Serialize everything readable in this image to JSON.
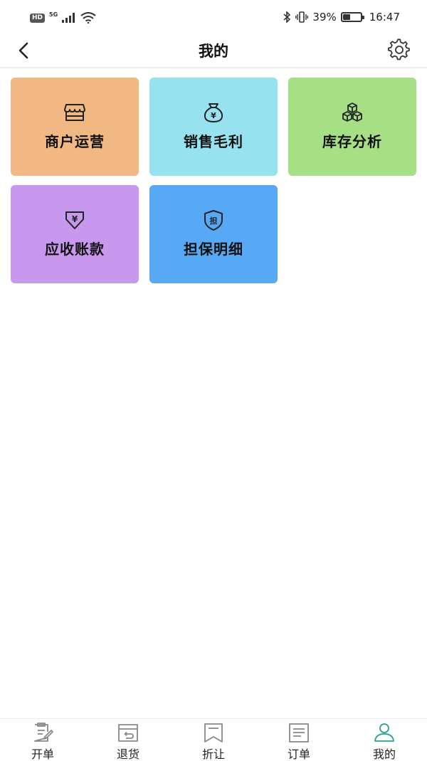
{
  "status_bar": {
    "hd": "HD",
    "network": "5G",
    "battery_percent": "39%",
    "battery_level": 0.39,
    "time": "16:47"
  },
  "header": {
    "title": "我的",
    "back_icon": "chevron-left-icon",
    "settings_icon": "gear-icon"
  },
  "tiles": [
    {
      "label": "商户运营",
      "icon": "storefront-icon",
      "color": "#f2b883"
    },
    {
      "label": "销售毛利",
      "icon": "money-bag-icon",
      "color": "#96e2ee"
    },
    {
      "label": "库存分析",
      "icon": "boxes-icon",
      "color": "#a6df85"
    },
    {
      "label": "应收账款",
      "icon": "yen-receive-icon",
      "color": "#c897ee"
    },
    {
      "label": "担保明细",
      "icon": "shield-guarantee-icon",
      "color": "#57a9f6"
    }
  ],
  "tabs": [
    {
      "label": "开单",
      "icon": "edit-document-icon"
    },
    {
      "label": "退货",
      "icon": "return-box-icon"
    },
    {
      "label": "折让",
      "icon": "bookmark-icon"
    },
    {
      "label": "订单",
      "icon": "order-list-icon"
    },
    {
      "label": "我的",
      "icon": "user-icon",
      "active": true
    }
  ],
  "colors": {
    "accent": "#2a9d8f",
    "icon_stroke": "#222222",
    "tab_icon": "#888888"
  }
}
